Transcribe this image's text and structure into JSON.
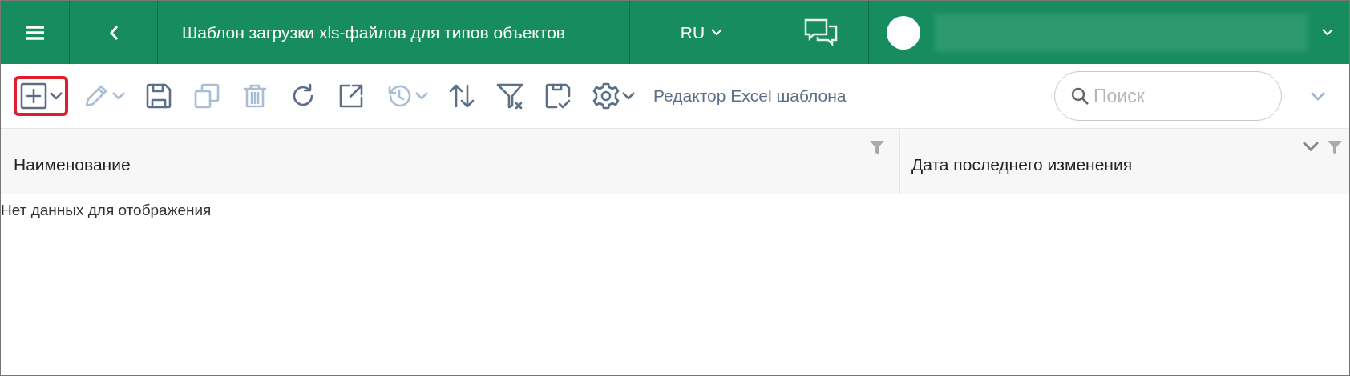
{
  "header": {
    "title": "Шаблон загрузки xls-файлов для типов объектов",
    "language": "RU"
  },
  "toolbar": {
    "buttons": [
      {
        "kind": "add",
        "disabled": false,
        "dropdown": true,
        "highlighted": true
      },
      {
        "kind": "edit",
        "disabled": true,
        "dropdown": true,
        "highlighted": false
      },
      {
        "kind": "save",
        "disabled": false,
        "dropdown": false,
        "highlighted": false
      },
      {
        "kind": "copy",
        "disabled": true,
        "dropdown": false,
        "highlighted": false
      },
      {
        "kind": "delete",
        "disabled": true,
        "dropdown": false,
        "highlighted": false
      },
      {
        "kind": "refresh",
        "disabled": false,
        "dropdown": false,
        "highlighted": false
      },
      {
        "kind": "export",
        "disabled": false,
        "dropdown": false,
        "highlighted": false
      },
      {
        "kind": "history",
        "disabled": true,
        "dropdown": true,
        "highlighted": false
      },
      {
        "kind": "sort",
        "disabled": false,
        "dropdown": false,
        "highlighted": false
      },
      {
        "kind": "unfilter",
        "disabled": false,
        "dropdown": false,
        "highlighted": false
      },
      {
        "kind": "savecheck",
        "disabled": false,
        "dropdown": false,
        "highlighted": false
      },
      {
        "kind": "settings",
        "disabled": false,
        "dropdown": true,
        "highlighted": false
      }
    ],
    "link": "Редактор Excel шаблона",
    "search": {
      "placeholder": "Поиск"
    }
  },
  "table": {
    "columns": [
      "Наименование",
      "Дата последнего изменения"
    ],
    "empty_message": "Нет данных для отображения"
  }
}
